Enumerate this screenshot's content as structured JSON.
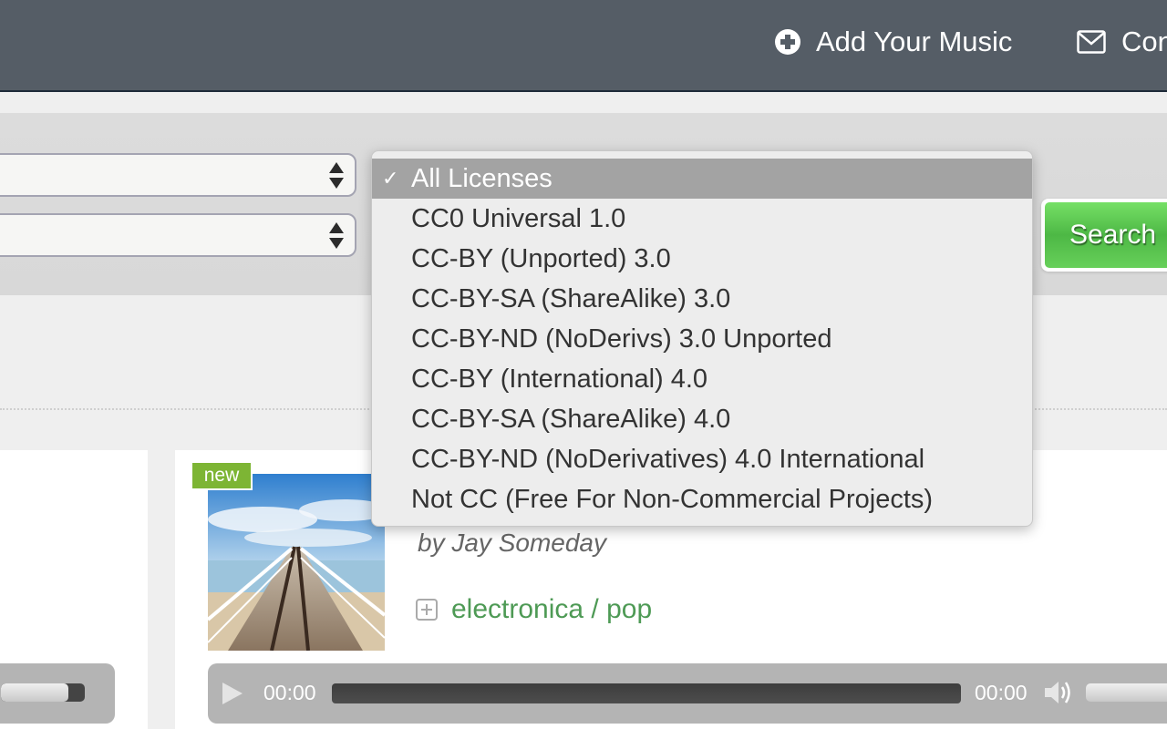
{
  "topnav": {
    "items": [
      {
        "label": "Add Your Music",
        "icon": "plus-circle-icon"
      },
      {
        "label": "Contact",
        "icon": "envelope-icon"
      }
    ]
  },
  "filters": {
    "select_1": {
      "value": ""
    },
    "select_2": {
      "value": ""
    },
    "license_select": {
      "selected": "All Licenses",
      "options": [
        {
          "label": "All Licenses",
          "selected": true
        },
        {
          "label": "CC0 Universal 1.0"
        },
        {
          "label": "CC-BY (Unported) 3.0"
        },
        {
          "label": "CC-BY-SA (ShareAlike) 3.0"
        },
        {
          "label": "CC-BY-ND (NoDerivs) 3.0 Unported"
        },
        {
          "label": "CC-BY (International) 4.0"
        },
        {
          "label": "CC-BY-SA (ShareAlike) 4.0"
        },
        {
          "label": "CC-BY-ND (NoDerivatives) 4.0 International"
        },
        {
          "label": "Not CC (Free For Non-Commercial Projects)"
        }
      ],
      "check_glyph": "✓"
    },
    "search_label": "Search"
  },
  "tracks": [
    {
      "badge": "new",
      "artist": "by Jay Someday",
      "genre": "electronica / pop",
      "player": {
        "current_time": "00:00",
        "duration": "00:00",
        "progress": 0,
        "volume": 1.0
      }
    }
  ],
  "left_player": {
    "volume": 0.8
  },
  "colors": {
    "nav_bg": "#555d66",
    "search_green": "#4db845",
    "badge_green": "#7db534",
    "genre_link": "#4e9a55",
    "selected_option_bg": "#a3a3a3"
  }
}
